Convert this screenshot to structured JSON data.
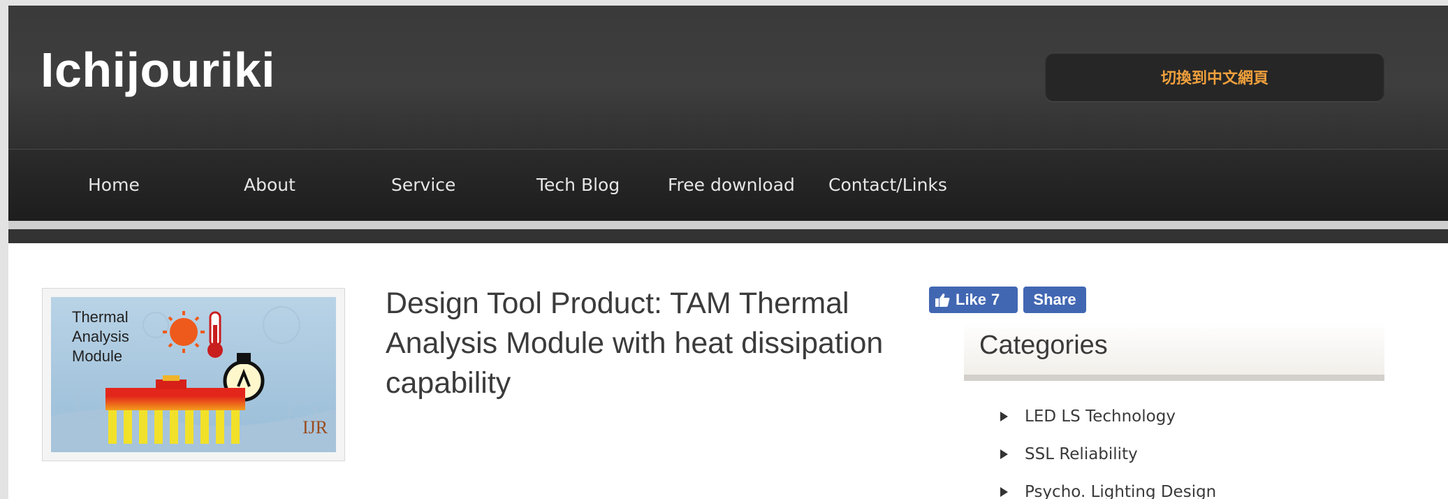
{
  "site": {
    "logo": "Ichijouriki",
    "language_button": "切換到中文網頁"
  },
  "nav": [
    {
      "label": "Home"
    },
    {
      "label": "About"
    },
    {
      "label": "Service"
    },
    {
      "label": "Tech Blog"
    },
    {
      "label": "Free download"
    },
    {
      "label": "Contact/Links"
    }
  ],
  "thumbnail": {
    "lines": [
      "Thermal",
      "Analysis",
      "Module"
    ],
    "mark": "IJR",
    "icons": [
      "sun-icon",
      "thermometer-icon",
      "light-bulb-icon",
      "heat-sink-icon"
    ]
  },
  "post": {
    "title": "Design Tool Product: TAM Thermal Analysis Module with heat dissipation capability"
  },
  "social": {
    "like_label": "Like",
    "like_count": "7",
    "share_label": "Share"
  },
  "sidebar": {
    "title": "Categories",
    "items": [
      {
        "label": "LED LS Technology"
      },
      {
        "label": "SSL Reliability"
      },
      {
        "label": "Psycho. Lighting Design"
      }
    ]
  },
  "colors": {
    "header_bg": "#3c3c3c",
    "nav_bg": "#242424",
    "accent_orange": "#f0a03c",
    "facebook_blue": "#4267b2"
  }
}
